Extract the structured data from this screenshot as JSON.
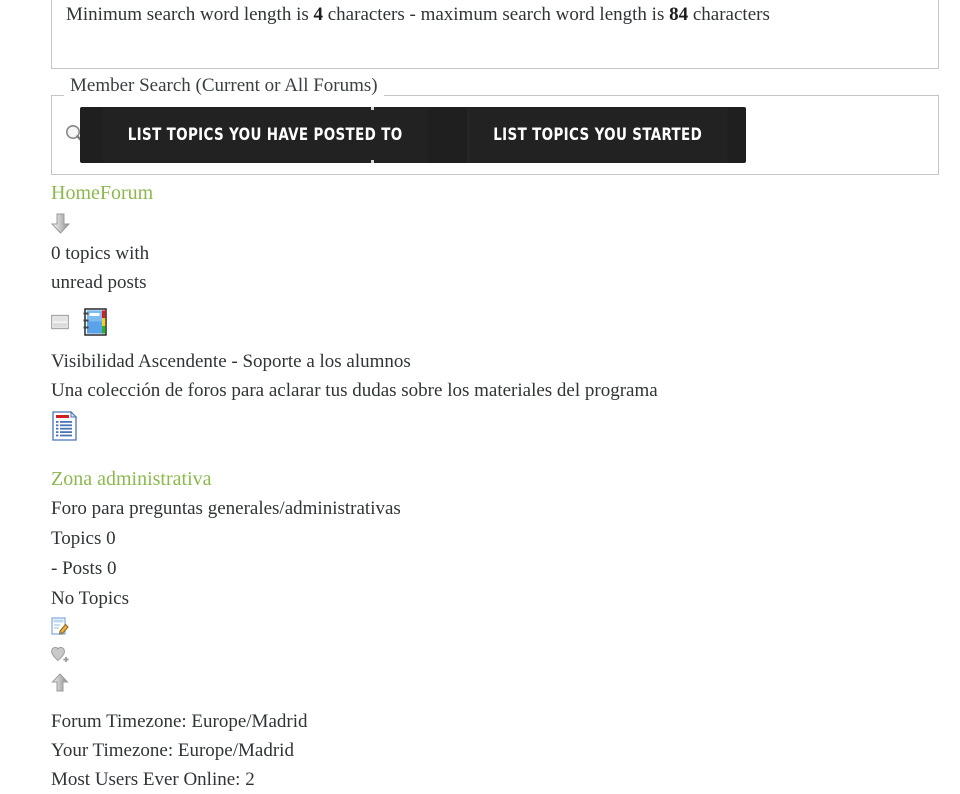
{
  "search_info": {
    "prefix": "Minimum search word length is ",
    "min_length": "4",
    "middle": " characters - maximum search word length is ",
    "max_length": "84",
    "suffix": " characters"
  },
  "member_search": {
    "legend": "Member Search (Current or All Forums)",
    "search_icon": "search-icon",
    "buttons": [
      {
        "label": "List Topics You Have Posted To",
        "name": "list-topics-posted-to-button"
      },
      {
        "label": "List Topics You Started",
        "name": "list-topics-started-button"
      }
    ]
  },
  "breadcrumb": {
    "home": "Home",
    "forum": "Forum",
    "combined": "HomeForum"
  },
  "unread": {
    "arrow_icon": "arrow-down-icon",
    "line1": "0 topics with",
    "line2": "unread posts"
  },
  "category": {
    "collapse_icon": "collapse-icon",
    "notebook_icon": "notebook-icon",
    "title": "Visibilidad Ascendente - Soporte a los alumnos",
    "description": "Una colección de foros para aclarar tus dudas sobre los materiales del programa"
  },
  "forum": {
    "doclist_icon": "document-list-icon",
    "name": "Zona administrativa",
    "description": "Foro para preguntas generales/administrativas",
    "topics_label": "Topics 0",
    "posts_label": " - Posts 0",
    "last_post": "No Topics"
  },
  "actions": {
    "mark_read_icon": "mark-read-icon",
    "subscribe_icon": "heart-plus-icon",
    "back_to_top_icon": "arrow-up-icon"
  },
  "footer": {
    "forum_timezone": "Forum Timezone: Europe/Madrid",
    "your_timezone": "Your Timezone: Europe/Madrid",
    "most_users_online": "Most Users Ever Online: 2"
  },
  "colors": {
    "link_green": "#8cb84e",
    "button_dark": "#222222",
    "text": "#2f3436",
    "border": "#c6c6c6"
  }
}
